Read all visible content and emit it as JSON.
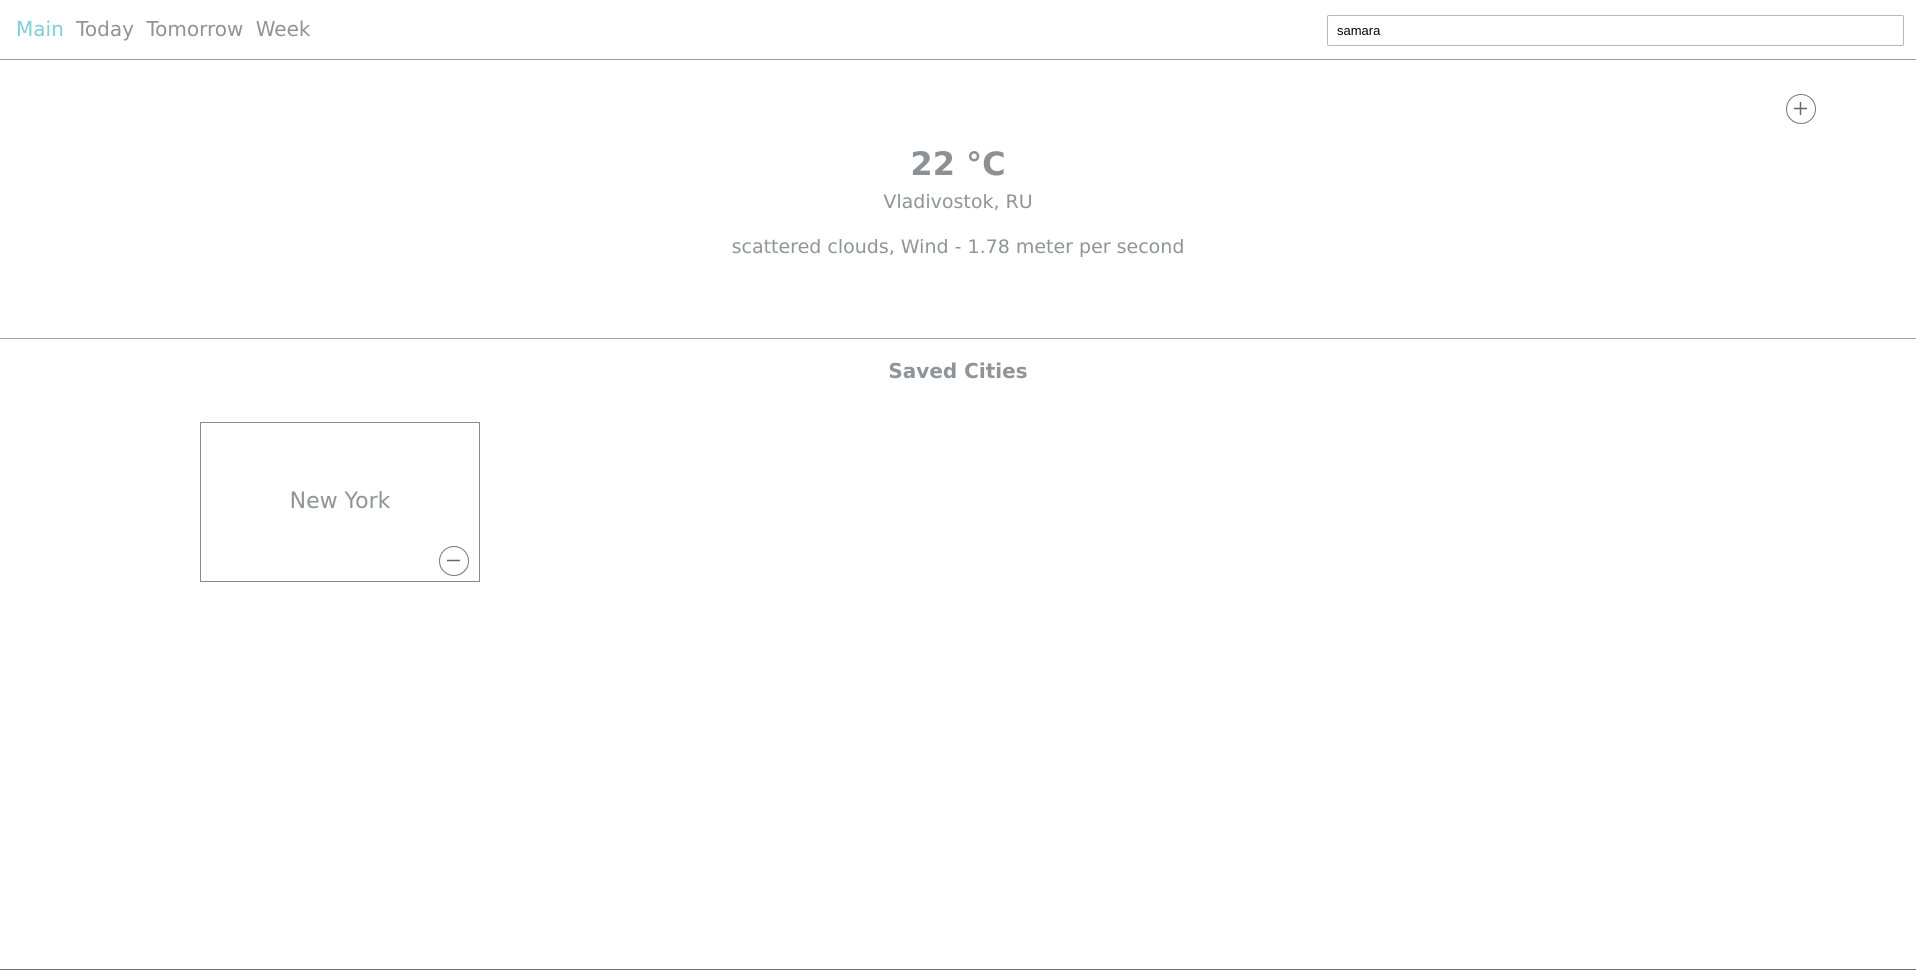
{
  "nav": {
    "items": [
      {
        "label": "Main",
        "active": true
      },
      {
        "label": "Today",
        "active": false
      },
      {
        "label": "Tomorrow",
        "active": false
      },
      {
        "label": "Week",
        "active": false
      }
    ]
  },
  "search": {
    "value": "samara"
  },
  "current": {
    "temperature": "22 °C",
    "location": "Vladivostok, RU",
    "description": "scattered clouds, Wind - 1.78 meter per second",
    "add_icon": "plus-circle-icon"
  },
  "saved": {
    "title": "Saved Cities",
    "cities": [
      {
        "name": "New York",
        "remove_icon": "minus-circle-icon"
      }
    ]
  },
  "colors": {
    "accent": "#7fcfd6",
    "text": "#8f9498",
    "border": "#9a9a9a"
  }
}
